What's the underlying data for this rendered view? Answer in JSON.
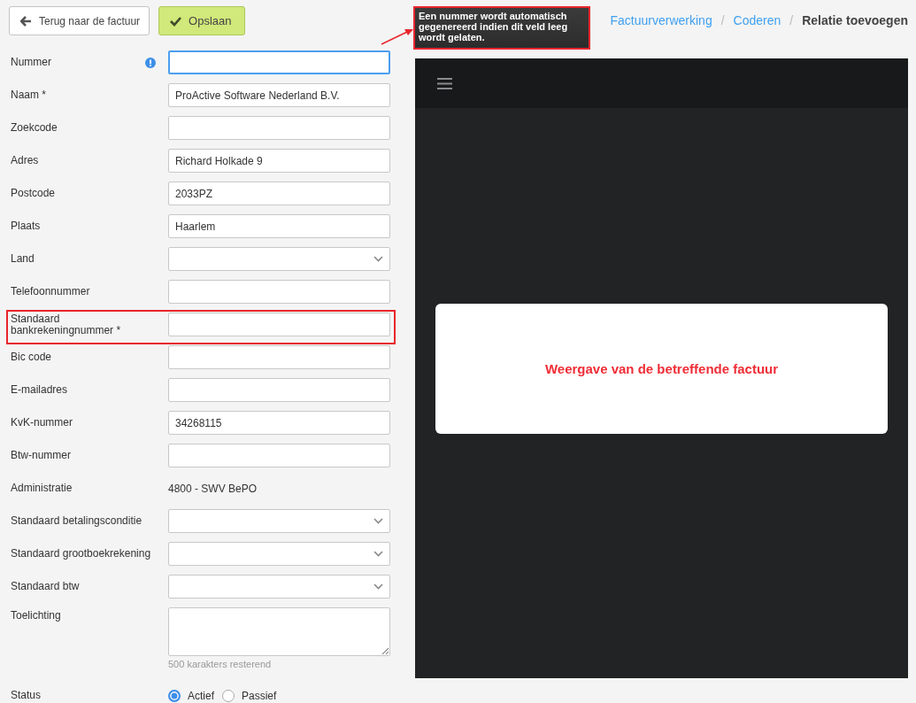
{
  "toolbar": {
    "back_button": "Terug naar de factuur",
    "save_button": "Opslaan"
  },
  "tooltip": {
    "text": "Een nummer wordt automatisch gegenereerd indien dit veld leeg wordt gelaten."
  },
  "breadcrumb": [
    {
      "label": "Factuurverwerking",
      "kind": "link"
    },
    {
      "label": "/",
      "kind": "separator"
    },
    {
      "label": "Coderen",
      "kind": "link"
    },
    {
      "label": "/",
      "kind": "separator"
    },
    {
      "label": "Relatie toevoegen",
      "kind": "current"
    }
  ],
  "fields": [
    {
      "label": "Nummer",
      "kind": "text",
      "info": true,
      "focused": true
    },
    {
      "label": "Naam *",
      "kind": "text",
      "value": "ProActive Software Nederland B.V."
    },
    {
      "label": "Zoekcode",
      "kind": "text"
    },
    {
      "label": "Adres",
      "kind": "text",
      "value": "Richard Holkade 9"
    },
    {
      "label": "Postcode",
      "kind": "text",
      "value": "2033PZ"
    },
    {
      "label": "Plaats",
      "kind": "text",
      "value": "Haarlem"
    },
    {
      "label": "Land",
      "kind": "select"
    },
    {
      "label": "Telefoonnummer",
      "kind": "text"
    },
    {
      "label": "Standaard bankrekeningnummer *",
      "kind": "text",
      "highlighted": true
    },
    {
      "label": "Bic code",
      "kind": "text"
    },
    {
      "label": "E-mailadres",
      "kind": "text"
    },
    {
      "label": "KvK-nummer",
      "kind": "text",
      "value": "34268115"
    },
    {
      "label": "Btw-nummer",
      "kind": "text"
    },
    {
      "label": "Administratie",
      "kind": "static",
      "value": "4800 - SWV BePO"
    },
    {
      "label": "Standaard betalingsconditie",
      "kind": "select"
    },
    {
      "label": "Standaard grootboekrekening",
      "kind": "select"
    },
    {
      "label": "Standaard btw",
      "kind": "select"
    },
    {
      "label": "Toelichting",
      "kind": "textarea",
      "hint": "500 karakters resterend"
    },
    {
      "label": "Status",
      "kind": "radio",
      "options": [
        {
          "label": "Actief",
          "selected": true
        },
        {
          "label": "Passief",
          "selected": false
        }
      ]
    }
  ],
  "preview": {
    "text": "Weergave van de betreffende factuur"
  }
}
